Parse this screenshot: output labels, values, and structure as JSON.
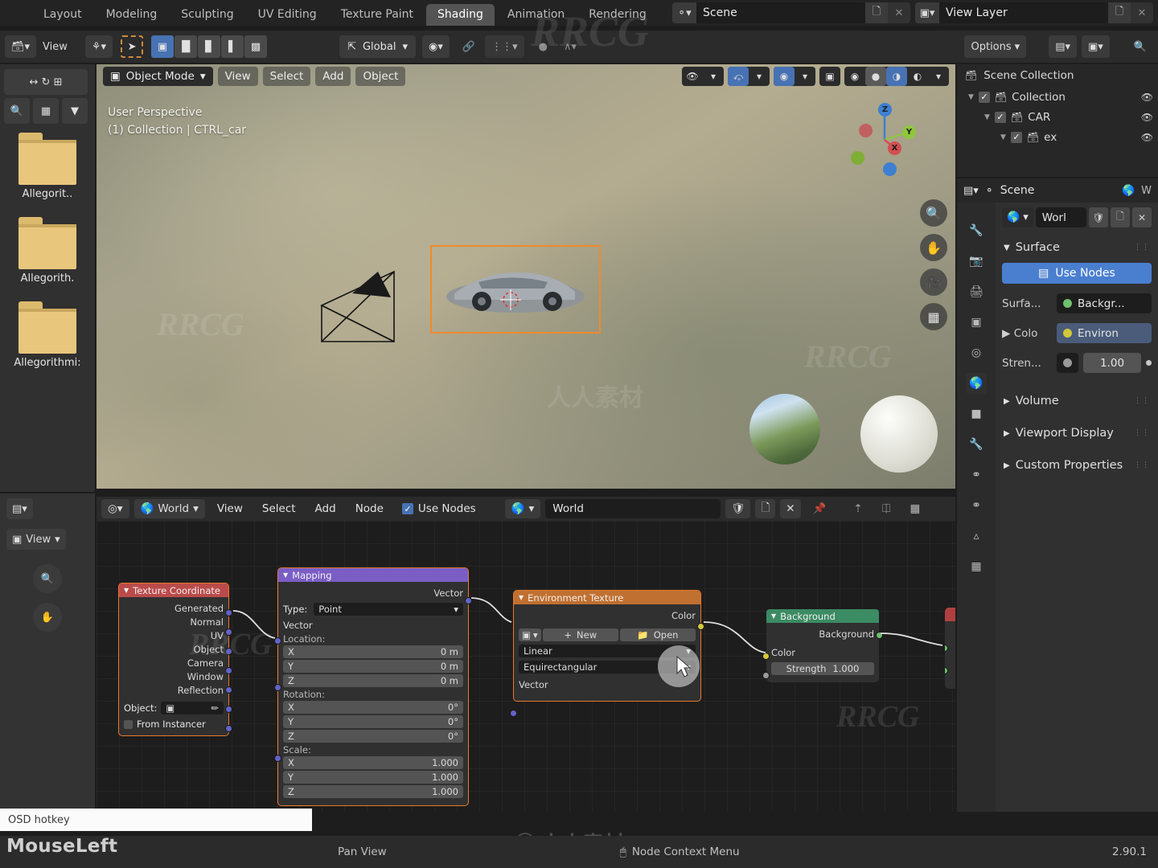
{
  "topbar": {
    "workspace_tabs": [
      {
        "label": "Layout",
        "active": false
      },
      {
        "label": "Modeling",
        "active": false
      },
      {
        "label": "Sculpting",
        "active": false
      },
      {
        "label": "UV Editing",
        "active": false
      },
      {
        "label": "Texture Paint",
        "active": false
      },
      {
        "label": "Shading",
        "active": true
      },
      {
        "label": "Animation",
        "active": false
      },
      {
        "label": "Rendering",
        "active": false
      }
    ],
    "scene_name": "Scene",
    "view_layer_name": "View Layer",
    "scene_icon": "scene-icon",
    "view_layer_icon": "images-icon",
    "new_copy_icon": "duplicate-icon",
    "close_icon": "x-icon"
  },
  "toolbar": {
    "editor_type_label": "editor-type",
    "view_label": "View",
    "snap_label": "snap",
    "orientation_label": "Global",
    "orientation_icon": "transform-orientation-icon",
    "pivot_icon": "pivot-point-icon",
    "snap_magnet_icon": "magnet-icon",
    "proportional_icon": "proportional-edit-icon",
    "options_label": "Options",
    "search_icon": "search-icon",
    "select_modes": [
      "tweak",
      "box",
      "circle",
      "lasso"
    ]
  },
  "left_sidebar": {
    "tools": [
      "back-arrow",
      "forward-arrow",
      "refresh-icon",
      "add-folder-icon",
      "search-icon",
      "grid-view-icon",
      "filter-icon"
    ],
    "files": [
      {
        "label": "Allegorit..",
        "icon": "folder-icon"
      },
      {
        "label": "Allegorith.",
        "icon": "folder-icon"
      },
      {
        "label": "Allegorithmi:",
        "icon": "folder-icon"
      }
    ],
    "bottom_editor_label": "View",
    "bottom_icons": [
      "zoom-icon",
      "pan-hand-icon"
    ]
  },
  "viewport": {
    "mode": "Object Mode",
    "menus": [
      "View",
      "Select",
      "Add",
      "Object"
    ],
    "overlay_line1": "User Perspective",
    "overlay_line2": "(1) Collection | CTRL_car",
    "gizmo_axes": [
      {
        "label": "Z",
        "color": "#3d7fd1"
      },
      {
        "label": "Y",
        "color": "#8fc63d"
      },
      {
        "label": "X",
        "color": "#d34f4f"
      }
    ],
    "nav_buttons": [
      "zoom-icon",
      "pan-hand-icon",
      "camera-icon",
      "grid-ortho-icon"
    ],
    "shading_modes": [
      "wireframe",
      "solid",
      "material-preview",
      "rendered"
    ],
    "active_shading": "material-preview",
    "selected_object_outline_color": "#f08a2a"
  },
  "outliner": {
    "rows": [
      {
        "label": "Scene Collection",
        "indent": 0,
        "has_checkbox": false,
        "has_eye": false,
        "icon": "collection-icon"
      },
      {
        "label": "Collection",
        "indent": 1,
        "has_checkbox": true,
        "has_eye": true,
        "icon": "collection-icon"
      },
      {
        "label": "CAR",
        "indent": 2,
        "has_checkbox": true,
        "has_eye": true,
        "icon": "collection-icon"
      },
      {
        "label": "ex",
        "indent": 3,
        "has_checkbox": true,
        "has_eye": true,
        "icon": "collection-icon"
      }
    ]
  },
  "properties": {
    "header_scene": "Scene",
    "header_world_icon": "world-icon",
    "datablock_name": "Worl",
    "datablock_icons": [
      "shield-icon",
      "duplicate-icon",
      "x-icon"
    ],
    "sections": [
      {
        "label": "Surface",
        "open": true
      },
      {
        "label": "Volume",
        "open": false
      },
      {
        "label": "Viewport Display",
        "open": false
      },
      {
        "label": "Custom Properties",
        "open": false
      }
    ],
    "use_nodes_label": "Use Nodes",
    "rows": [
      {
        "label": "Surfa...",
        "value": "Backgr...",
        "dot_color": "#6ec16e",
        "style": "dark"
      },
      {
        "label": "Colo",
        "value": "Environ",
        "dot_color": "#d3c83c",
        "style": "blue"
      },
      {
        "label": "Stren...",
        "value": "1.00",
        "dot_color": "#9a9a9a",
        "style": "gray"
      }
    ],
    "tabs": [
      "tool-icon",
      "render-icon",
      "output-icon",
      "view-layer-icon",
      "scene-icon",
      "world-icon",
      "object-icon",
      "modifier-icon",
      "physics-icon",
      "constraint-icon",
      "data-icon",
      "material-icon"
    ]
  },
  "shader_editor": {
    "shader_type_icon": "shader-type-icon",
    "context_icon": "world-icon",
    "context_label": "World",
    "menus": [
      "View",
      "Select",
      "Add",
      "Node"
    ],
    "use_nodes_label": "Use Nodes",
    "use_nodes_checked": true,
    "datablock_label": "World",
    "datablock_icons": [
      "shield-icon",
      "duplicate-icon",
      "x-icon",
      "pin-icon",
      "parent-icon",
      "snap-icon",
      "overlay-icon"
    ],
    "nodes": [
      {
        "name": "Texture Coordinate",
        "header_color": "#bb4b4b",
        "outputs": [
          "Generated",
          "Normal",
          "UV",
          "Object",
          "Camera",
          "Window",
          "Reflection"
        ],
        "object_label": "Object:",
        "from_instancer_label": "From Instancer"
      },
      {
        "name": "Mapping",
        "header_color": "#7a5ec6",
        "output_label": "Vector",
        "type_label": "Type:",
        "type_value": "Point",
        "input_label": "Vector",
        "location_label": "Location:",
        "location": [
          {
            "axis": "X",
            "value": "0 m"
          },
          {
            "axis": "Y",
            "value": "0 m"
          },
          {
            "axis": "Z",
            "value": "0 m"
          }
        ],
        "rotation_label": "Rotation:",
        "rotation": [
          {
            "axis": "X",
            "value": "0°"
          },
          {
            "axis": "Y",
            "value": "0°"
          },
          {
            "axis": "Z",
            "value": "0°"
          }
        ],
        "scale_label": "Scale:",
        "scale": [
          {
            "axis": "X",
            "value": "1.000"
          },
          {
            "axis": "Y",
            "value": "1.000"
          },
          {
            "axis": "Z",
            "value": "1.000"
          }
        ]
      },
      {
        "name": "Environment Texture",
        "header_color": "#c07030",
        "output_label": "Color",
        "new_label": "New",
        "open_label": "Open",
        "interpolation": "Linear",
        "projection": "Equirectangular",
        "input_label": "Vector"
      },
      {
        "name": "Background",
        "header_color": "#3b8b63",
        "output_label": "Background",
        "color_label": "Color",
        "strength_label": "Strength",
        "strength_value": "1.000"
      }
    ]
  },
  "status": {
    "osd_text": "OSD hotkey",
    "mouse_label": "MouseLeft",
    "pan_view_label": "Pan View",
    "context_menu_label": "Node Context Menu",
    "version": "2.90.1"
  }
}
